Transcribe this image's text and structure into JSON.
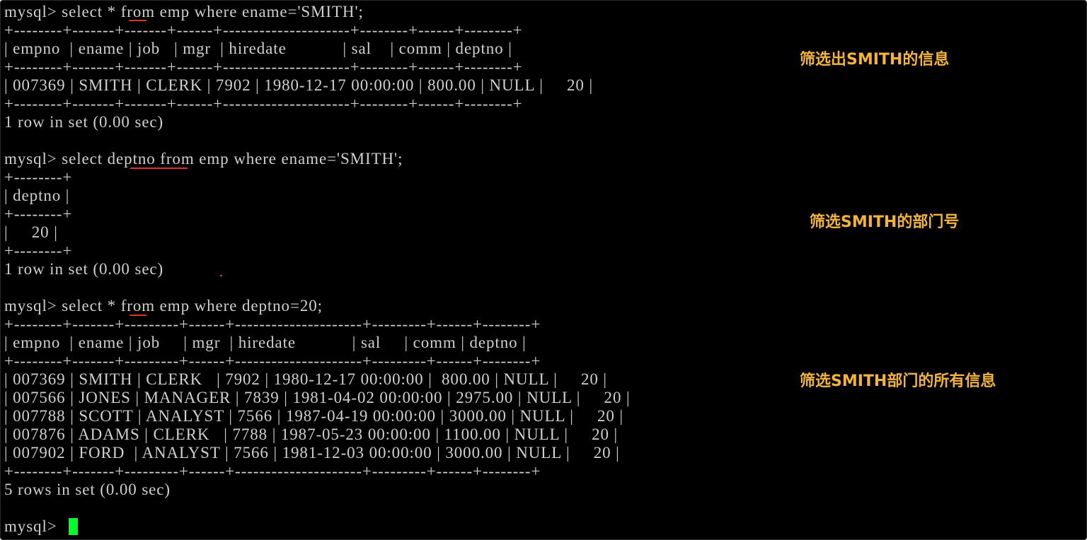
{
  "colors": {
    "background": "#000000",
    "text": "#cfcfcf",
    "annotation": "#f3b33d",
    "underline": "#e0322f",
    "cursor": "#00ff2a"
  },
  "terminal": {
    "lines": [
      "mysql> select * from emp where ename='SMITH';",
      "+--------+-------+-------+------+---------------------+--------+------+--------+",
      "| empno  | ename | job   | mgr  | hiredate            | sal    | comm | deptno |",
      "+--------+-------+-------+------+---------------------+--------+------+--------+",
      "| 007369 | SMITH | CLERK | 7902 | 1980-12-17 00:00:00 | 800.00 | NULL |     20 |",
      "+--------+-------+-------+------+---------------------+--------+------+--------+",
      "1 row in set (0.00 sec)",
      "",
      "mysql> select deptno from emp where ename='SMITH';",
      "+--------+",
      "| deptno |",
      "+--------+",
      "|     20 |",
      "+--------+",
      "1 row in set (0.00 sec)",
      "",
      "mysql> select * from emp where deptno=20;",
      "+--------+-------+---------+------+---------------------+---------+------+--------+",
      "| empno  | ename | job     | mgr  | hiredate            | sal     | comm | deptno |",
      "+--------+-------+---------+------+---------------------+---------+------+--------+",
      "| 007369 | SMITH | CLERK   | 7902 | 1980-12-17 00:00:00 |  800.00 | NULL |     20 |",
      "| 007566 | JONES | MANAGER | 7839 | 1981-04-02 00:00:00 | 2975.00 | NULL |     20 |",
      "| 007788 | SCOTT | ANALYST | 7566 | 1987-04-19 00:00:00 | 3000.00 | NULL |     20 |",
      "| 007876 | ADAMS | CLERK   | 7788 | 1987-05-23 00:00:00 | 1100.00 | NULL |     20 |",
      "| 007902 | FORD  | ANALYST | 7566 | 1981-12-03 00:00:00 | 3000.00 | NULL |     20 |",
      "+--------+-------+---------+------+---------------------+---------+------+--------+",
      "5 rows in set (0.00 sec)",
      "",
      "mysql> "
    ]
  },
  "annotations": [
    "筛选出SMITH的信息",
    "筛选SMITH的部门号",
    "筛选SMITH部门的所有信息"
  ]
}
